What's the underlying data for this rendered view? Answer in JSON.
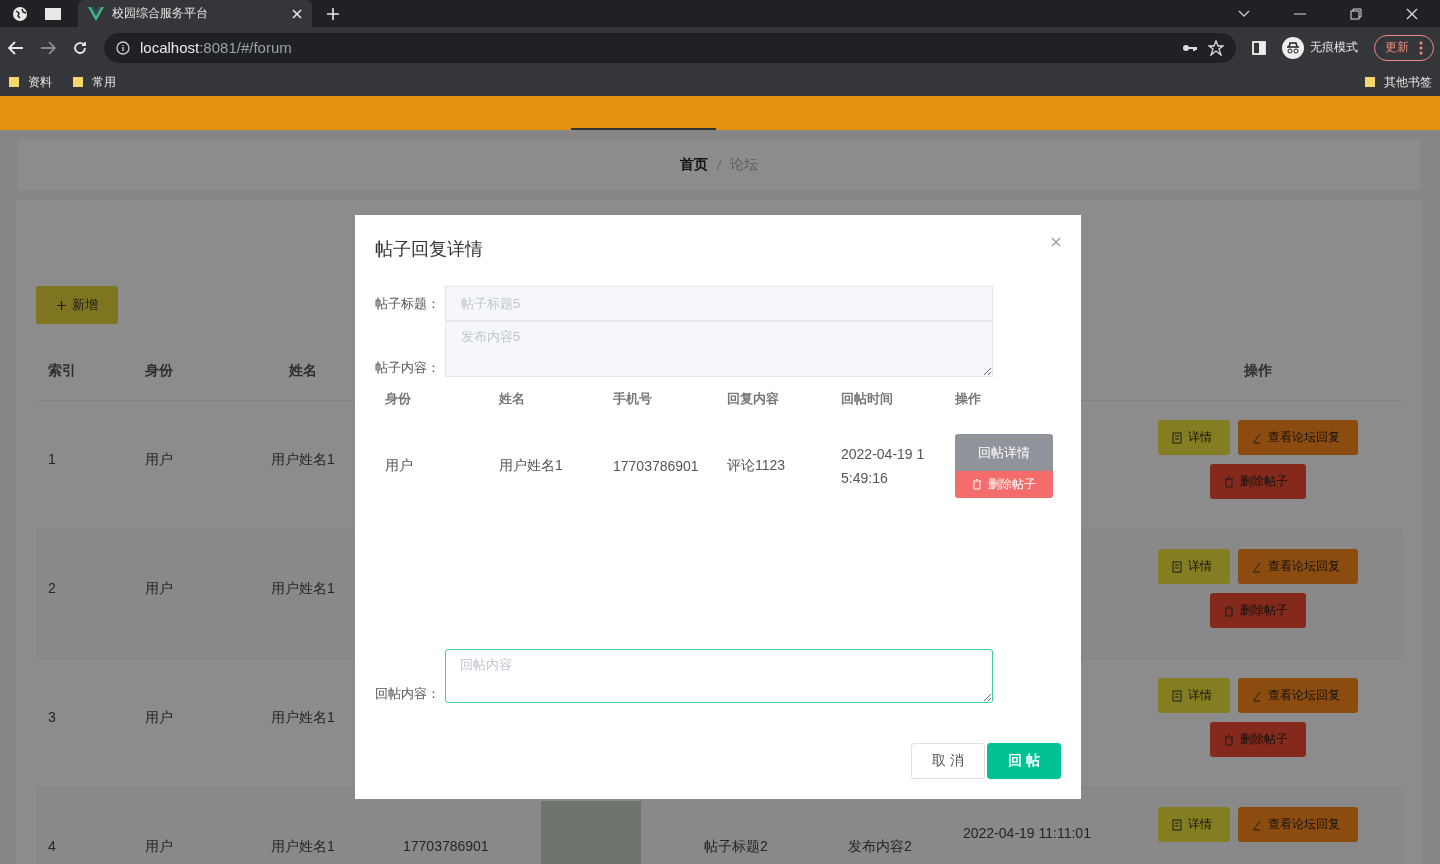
{
  "browser": {
    "tab_title": "校园综合服务平台",
    "address_host": "localhost",
    "address_rest": ":8081/#/forum",
    "profile_label": "无痕模式",
    "update_button": "更新",
    "bookmarks": [
      "资料",
      "常用"
    ],
    "other_bookmarks": "其他书签"
  },
  "breadcrumb": [
    "首页",
    "论坛"
  ],
  "add_button": "新增",
  "table": {
    "header": {
      "index": "索引",
      "role": "身份",
      "name": "姓名",
      "actions": "操作"
    },
    "rows": [
      {
        "index": "1",
        "role": "用户",
        "name": "用户姓名1",
        "actions": [
          {
            "label": "详情",
            "kind": "detail"
          },
          {
            "label": "查看论坛回复",
            "kind": "replies"
          },
          {
            "label": "删除帖子",
            "kind": "delete"
          }
        ]
      },
      {
        "index": "2",
        "role": "用户",
        "name": "用户姓名1",
        "actions": [
          {
            "label": "详情",
            "kind": "detail"
          },
          {
            "label": "查看论坛回复",
            "kind": "replies"
          },
          {
            "label": "删除帖子",
            "kind": "delete"
          }
        ]
      },
      {
        "index": "3",
        "role": "用户",
        "name": "用户姓名1",
        "actions": [
          {
            "label": "详情",
            "kind": "detail"
          },
          {
            "label": "查看论坛回复",
            "kind": "replies"
          },
          {
            "label": "删除帖子",
            "kind": "delete"
          }
        ]
      },
      {
        "index": "4",
        "role": "用户",
        "name": "用户姓名1",
        "phone": "17703786901",
        "has_photo": true,
        "title": "帖子标题2",
        "content": "发布内容2",
        "time": "2022-04-19 11:11:01",
        "actions": [
          {
            "label": "详情",
            "kind": "detail"
          },
          {
            "label": "查看论坛回复",
            "kind": "replies"
          }
        ]
      }
    ]
  },
  "dialog": {
    "title": "帖子回复详情",
    "fields": [
      {
        "label": "帖子标题：",
        "value": "帖子标题5",
        "kind": "input",
        "disabled": true
      },
      {
        "label": "帖子内容：",
        "value": "发布内容5",
        "kind": "textarea",
        "disabled": true
      }
    ],
    "reply_table": {
      "columns": [
        "身份",
        "姓名",
        "手机号",
        "回复内容",
        "回帖时间",
        "操作"
      ],
      "rows": [
        {
          "role": "用户",
          "name": "用户姓名1",
          "phone": "17703786901",
          "content": "评论1123",
          "time": "2022-04-19 15:49:16",
          "actions": [
            {
              "label": "回帖详情",
              "kind": "detail"
            },
            {
              "label": "删除帖子",
              "kind": "delete"
            }
          ]
        }
      ]
    },
    "reply_field": {
      "label": "回帖内容：",
      "placeholder": "回帖内容"
    },
    "buttons": [
      {
        "label": "取 消",
        "kind": "cancel"
      },
      {
        "label": "回 帖",
        "kind": "primary"
      }
    ]
  }
}
